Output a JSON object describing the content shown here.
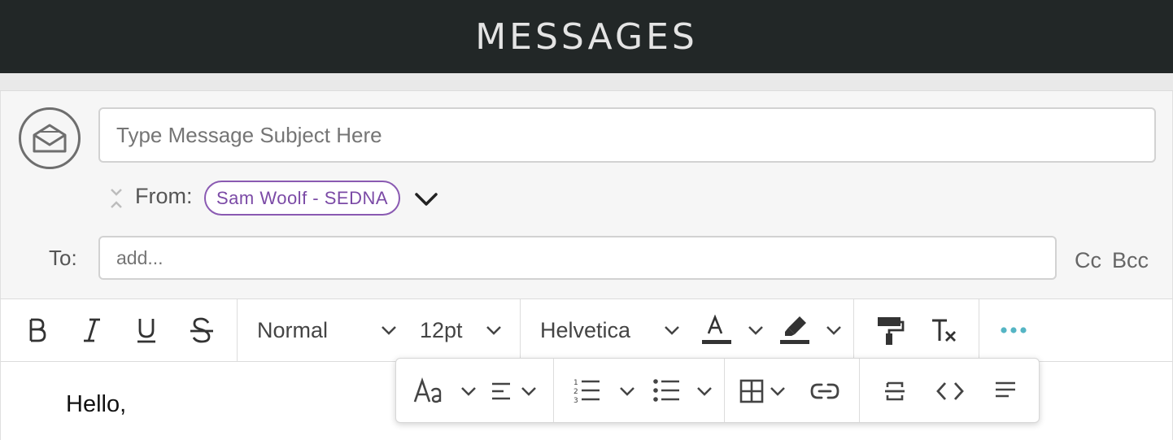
{
  "app": {
    "title": "MESSAGES"
  },
  "compose": {
    "subject_placeholder": "Type Message Subject Here",
    "subject_value": "",
    "from_label": "From:",
    "from_value": "Sam Woolf - SEDNA",
    "to_label": "To:",
    "to_placeholder": "add...",
    "cc_label": "Cc",
    "bcc_label": "Bcc"
  },
  "toolbar": {
    "block_format": "Normal",
    "font_size": "12pt",
    "font_family": "Helvetica",
    "buttons": [
      "bold-icon",
      "italic-icon",
      "underline-icon",
      "strikethrough-icon",
      "text-color-icon",
      "highlight-icon",
      "format-painter-icon",
      "clear-formatting-icon",
      "more-icon"
    ]
  },
  "popup_toolbar": {
    "buttons": [
      "font-case-icon",
      "align-left-icon",
      "numbered-list-icon",
      "bulleted-list-icon",
      "table-icon",
      "link-icon",
      "horizontal-line-icon",
      "code-icon",
      "paragraph-icon"
    ]
  },
  "editor": {
    "body_text": "Hello,"
  },
  "colors": {
    "topbar": "#222727",
    "chip_border": "#8a5ab2",
    "more_icon": "#55b5c4"
  }
}
